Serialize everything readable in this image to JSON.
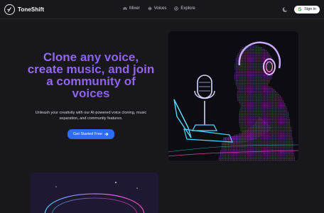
{
  "brand": {
    "name": "ToneShift"
  },
  "nav": {
    "items": [
      {
        "label": "Mixer",
        "icon": "sliders-icon"
      },
      {
        "label": "Voices",
        "icon": "waveform-icon"
      },
      {
        "label": "Explore",
        "icon": "compass-icon"
      }
    ]
  },
  "header": {
    "signin_label": "Sign in"
  },
  "hero": {
    "title_lines": [
      "Clone any voice,",
      "create music, and join",
      "a community of",
      "voices"
    ],
    "subtitle": "Unleash your creativity with our AI-powered voice cloning, music separation, and community features.",
    "cta_label": "Get Started Free"
  },
  "colors": {
    "background": "#17171c",
    "accent_gradient_start": "#9d6cf2",
    "cta": "#2f6cf5",
    "illustration_cyan": "#4fd8ff",
    "illustration_pink": "#e651c8"
  }
}
